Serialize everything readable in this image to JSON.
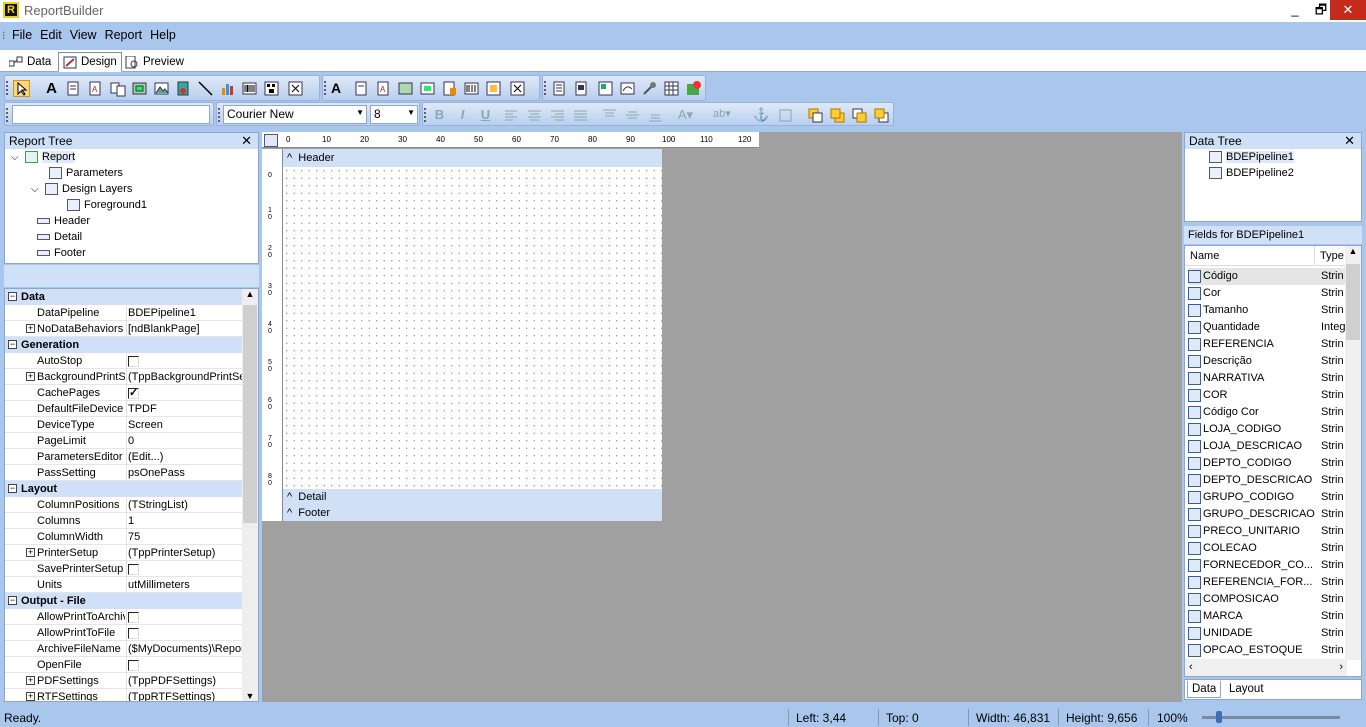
{
  "window": {
    "title": "ReportBuilder",
    "icon": "reportbuilder-app-icon",
    "controls": {
      "minimize": "_",
      "maximize": "🗗",
      "close": "✕"
    }
  },
  "menu": [
    "File",
    "Edit",
    "View",
    "Report",
    "Help"
  ],
  "tabs": [
    {
      "label": "Data",
      "icon": "data-icon"
    },
    {
      "label": "Design",
      "icon": "design-icon",
      "active": true
    },
    {
      "label": "Preview",
      "icon": "preview-icon"
    }
  ],
  "toolbar_format": {
    "font": "Courier New",
    "size": "8"
  },
  "report_tree": {
    "title": "Report Tree",
    "items": [
      "Report",
      "Parameters",
      "Design Layers",
      "Foreground1",
      "Header",
      "Detail",
      "Footer"
    ]
  },
  "properties": {
    "categories": [
      "Data",
      "Generation",
      "Layout",
      "Output - File"
    ],
    "rows": [
      {
        "name": "DataPipeline",
        "value": "BDEPipeline1"
      },
      {
        "name": "NoDataBehaviors",
        "value": "[ndBlankPage]"
      },
      {
        "name": "AutoStop",
        "value": ""
      },
      {
        "name": "BackgroundPrintSe",
        "value": "(TppBackgroundPrintSet"
      },
      {
        "name": "CachePages",
        "value": ""
      },
      {
        "name": "DefaultFileDevice",
        "value": "TPDF"
      },
      {
        "name": "DeviceType",
        "value": "Screen"
      },
      {
        "name": "PageLimit",
        "value": "0"
      },
      {
        "name": "ParametersEditor",
        "value": "(Edit...)"
      },
      {
        "name": "PassSetting",
        "value": "psOnePass"
      },
      {
        "name": "ColumnPositions",
        "value": "(TStringList)"
      },
      {
        "name": "Columns",
        "value": "1"
      },
      {
        "name": "ColumnWidth",
        "value": "75"
      },
      {
        "name": "PrinterSetup",
        "value": "(TppPrinterSetup)"
      },
      {
        "name": "SavePrinterSetup",
        "value": ""
      },
      {
        "name": "Units",
        "value": "utMillimeters"
      },
      {
        "name": "AllowPrintToArchiv",
        "value": ""
      },
      {
        "name": "AllowPrintToFile",
        "value": ""
      },
      {
        "name": "ArchiveFileName",
        "value": "($MyDocuments)\\Report"
      },
      {
        "name": "OpenFile",
        "value": ""
      },
      {
        "name": "PDFSettings",
        "value": "(TppPDFSettings)"
      },
      {
        "name": "RTFSettings",
        "value": "(TppRTFSettings)"
      }
    ],
    "checked": {
      "AutoStop": false,
      "CachePages": true,
      "SavePrinterSetup": false,
      "AllowPrintToArchiv": false,
      "AllowPrintToFile": false,
      "OpenFile": false
    }
  },
  "ruler_labels": [
    "0",
    "10",
    "20",
    "30",
    "40",
    "50",
    "60",
    "70",
    "80",
    "90",
    "100",
    "110",
    "120"
  ],
  "ruler_v_labels": [
    "0",
    "1 0",
    "2 0",
    "3 0",
    "4 0",
    "5 0",
    "6 0",
    "7 0",
    "8 0"
  ],
  "bands": {
    "header": "Header",
    "detail": "Detail",
    "footer": "Footer"
  },
  "data_tree": {
    "title": "Data Tree",
    "pipelines": [
      "BDEPipeline1",
      "BDEPipeline2"
    ]
  },
  "fields": {
    "title": "Fields for BDEPipeline1",
    "col_name": "Name",
    "col_type": "Type",
    "rows": [
      {
        "name": "Código",
        "type": "Strin"
      },
      {
        "name": "Cor",
        "type": "Strin"
      },
      {
        "name": "Tamanho",
        "type": "Strin"
      },
      {
        "name": "Quantidade",
        "type": "Integ"
      },
      {
        "name": "REFERENCIA",
        "type": "Strin"
      },
      {
        "name": "Descrição",
        "type": "Strin"
      },
      {
        "name": "NARRATIVA",
        "type": "Strin"
      },
      {
        "name": "COR",
        "type": "Strin"
      },
      {
        "name": "Código Cor",
        "type": "Strin"
      },
      {
        "name": "LOJA_CODIGO",
        "type": "Strin"
      },
      {
        "name": "LOJA_DESCRICAO",
        "type": "Strin"
      },
      {
        "name": "DEPTO_CODIGO",
        "type": "Strin"
      },
      {
        "name": "DEPTO_DESCRICAO",
        "type": "Strin"
      },
      {
        "name": "GRUPO_CODIGO",
        "type": "Strin"
      },
      {
        "name": "GRUPO_DESCRICAO",
        "type": "Strin"
      },
      {
        "name": "PRECO_UNITARIO",
        "type": "Strin"
      },
      {
        "name": "COLECAO",
        "type": "Strin"
      },
      {
        "name": "FORNECEDOR_CO...",
        "type": "Strin"
      },
      {
        "name": "REFERENCIA_FOR...",
        "type": "Strin"
      },
      {
        "name": "COMPOSICAO",
        "type": "Strin"
      },
      {
        "name": "MARCA",
        "type": "Strin"
      },
      {
        "name": "UNIDADE",
        "type": "Strin"
      },
      {
        "name": "OPCAO_ESTOQUE",
        "type": "Strin"
      }
    ]
  },
  "data_tree_tabs": [
    "Data",
    "Layout"
  ],
  "status": {
    "message": "Ready.",
    "left": "Left: 3,44",
    "top": "Top: 0",
    "width": "Width: 46,831",
    "height": "Height: 9,656",
    "zoom": "100%"
  }
}
